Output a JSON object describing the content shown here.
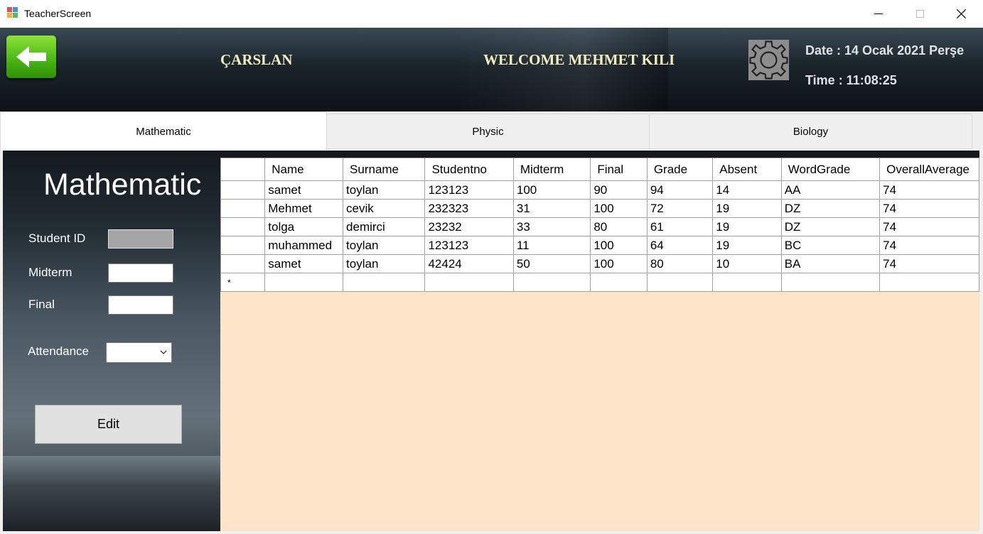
{
  "window": {
    "title": "TeacherScreen",
    "minimize": "—",
    "maximize": "☐",
    "close": "✕"
  },
  "header": {
    "brand": "ÇARSLAN",
    "welcome": "WELCOME MEHMET KILI",
    "date": "Date : 14 Ocak 2021 Perşe",
    "time": "Time : 11:08:25"
  },
  "tabs": [
    {
      "label": "Mathematic",
      "active": true
    },
    {
      "label": "Physic",
      "active": false
    },
    {
      "label": "Biology",
      "active": false
    }
  ],
  "panel": {
    "subject": "Mathematic",
    "student_id_label": "Student ID",
    "midterm_label": "Midterm",
    "final_label": "Final",
    "attendance_label": "Attendance",
    "edit_label": "Edit"
  },
  "grid": {
    "columns": [
      "Name",
      "Surname",
      "Studentno",
      "Midterm",
      "Final",
      "Grade",
      "Absent",
      "WordGrade",
      "OverallAverage"
    ],
    "rows": [
      [
        "samet",
        "toylan",
        "123123",
        "100",
        "90",
        "94",
        "14",
        "AA",
        "74"
      ],
      [
        "Mehmet",
        "cevik",
        "232323",
        "31",
        "100",
        "72",
        "19",
        "DZ",
        "74"
      ],
      [
        "tolga",
        "demirci",
        "23232",
        "33",
        "80",
        "61",
        "19",
        "DZ",
        "74"
      ],
      [
        "muhammed",
        "toylan",
        "123123",
        "11",
        "100",
        "64",
        "19",
        "BC",
        "74"
      ],
      [
        "samet",
        "toylan",
        "42424",
        "50",
        "100",
        "80",
        "10",
        "BA",
        "74"
      ]
    ],
    "new_row_marker": "*"
  }
}
